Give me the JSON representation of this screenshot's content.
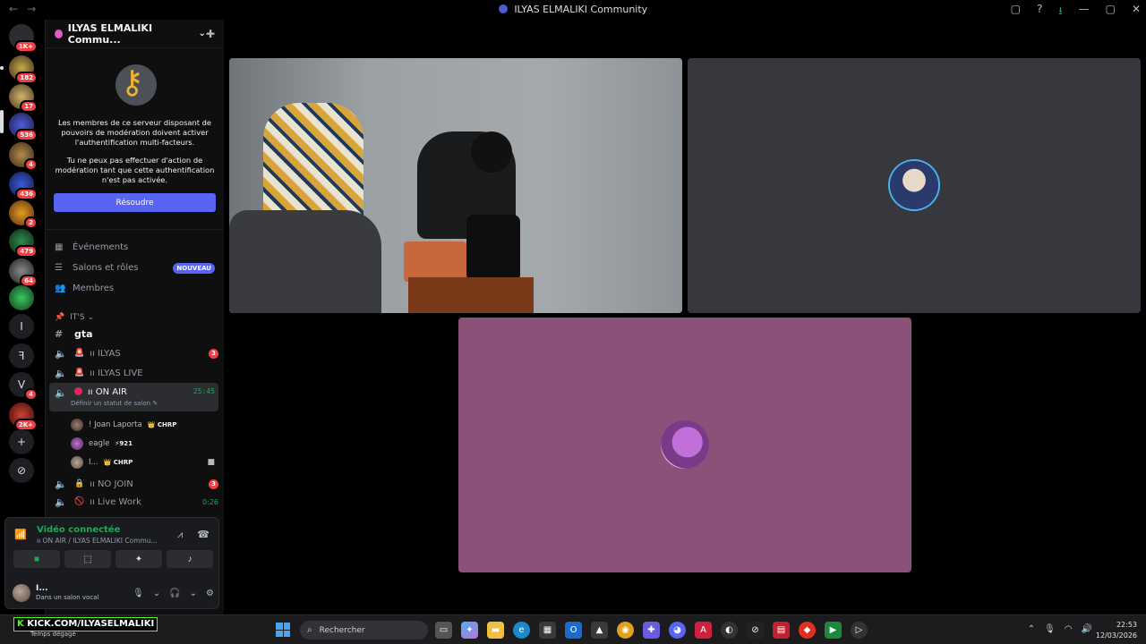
{
  "window": {
    "title": "ILYAS ELMALIKI Community",
    "nav_back": "←",
    "nav_forward": "→",
    "controls": [
      "▢",
      "?",
      "⭳",
      "—",
      "▢",
      "✕"
    ]
  },
  "rail": {
    "badges": [
      "1K+",
      "182",
      "17",
      "536",
      "4",
      "436",
      "2",
      "479",
      "64",
      "4",
      "2K+"
    ],
    "letters": [
      "I",
      "ꟻ",
      "V"
    ],
    "add": "+",
    "discover": "⊘"
  },
  "server": {
    "name": "ILYAS ELMALIKI Commu...",
    "chevron": "⌄",
    "invite_icon": "person-add-icon"
  },
  "mfa_notice": {
    "text1": "Les membres de ce serveur disposant de pouvoirs de modération doivent activer l'authentification multi-facteurs.",
    "text2": "Tu ne peux pas effectuer d'action de modération tant que cette authentification n'est pas activée.",
    "button": "Résoudre"
  },
  "menu": {
    "events": "Événements",
    "roles": "Salons et rôles",
    "new_badge": "NOUVEAU",
    "members": "Membres"
  },
  "category": {
    "name": "IT'S"
  },
  "channels": {
    "gta": "gta",
    "ilyas": "ıı ILYAS",
    "ilyas_count": "3",
    "ilyas_live": "ıı ILYAS LIVE",
    "on_air": "ıı ON AIR",
    "on_air_timer": "25:45",
    "on_air_status": "Définir un statut de salon ✎",
    "no_join": "ıı NO JOIN",
    "no_join_count": "3",
    "live_work": "ıı Live Work",
    "live_work_timer": "0:26"
  },
  "members": [
    {
      "name": "! Joan Laporta",
      "tag": "👑 CHRP"
    },
    {
      "name": "eagle",
      "tag": "⚡921"
    },
    {
      "name": "I...",
      "tag": "👑 CHRP"
    }
  ],
  "voice": {
    "status": "Vidéo connectée",
    "location": "ıı ON AIR / ILYAS ELMALIKI Commu...",
    "user_name": "I...",
    "user_status": "Dans un salon vocal"
  },
  "taskbar": {
    "brand_k": "K",
    "brand_text": "KICK.COM/ILYASELMALIKI",
    "weather": "Temps dégagé",
    "search": "Rechercher",
    "time": "22:53",
    "date": "12/03/2026"
  },
  "colors": {
    "accent": "#5865f2",
    "green": "#23a55a",
    "red": "#f23f43",
    "tile_grey": "#37383d",
    "tile_purple": "#8a5278"
  }
}
